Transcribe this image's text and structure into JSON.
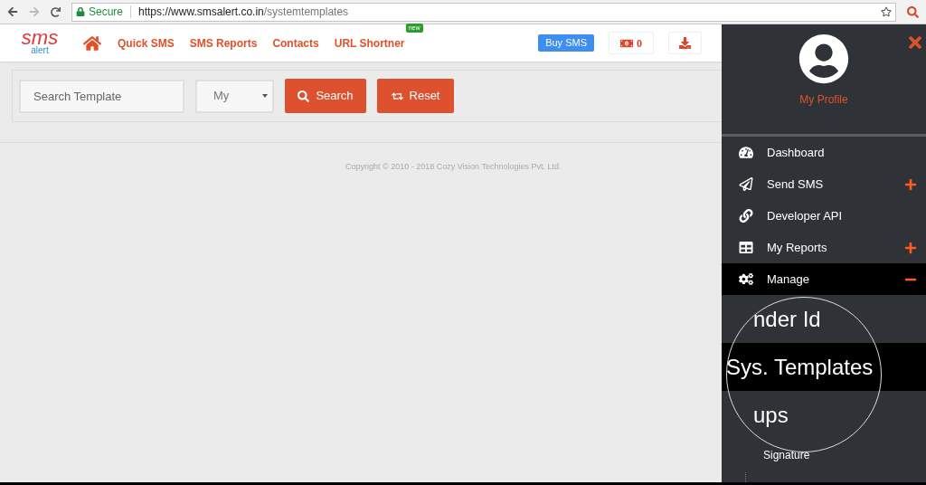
{
  "browser": {
    "secure_label": "Secure",
    "url_host": "https://www.smsalert.co.in",
    "url_path": "/systemtemplates"
  },
  "header": {
    "logo_main": "sms",
    "logo_sub": "alert",
    "nav": [
      {
        "label": "Quick SMS"
      },
      {
        "label": "SMS Reports"
      },
      {
        "label": "Contacts"
      },
      {
        "label": "URL Shortner",
        "badge": "new"
      }
    ],
    "buy_button": "Buy SMS",
    "credits": "0"
  },
  "filters": {
    "search_placeholder": "Search Template",
    "select_value": "My",
    "buttons": [
      {
        "label": "Search",
        "kind": "search"
      },
      {
        "label": "Reset",
        "kind": "reset"
      }
    ]
  },
  "footer": {
    "copyright": "Copyright © 2010 - 2018 Cozy Vision Technologies Pvt. Ltd."
  },
  "sidebar": {
    "profile_label": "My Profile",
    "menu": [
      {
        "label": "Dashboard",
        "kind": "dashboard",
        "selected": false
      },
      {
        "label": "Send SMS",
        "kind": "send",
        "selected": false,
        "expanded": false
      },
      {
        "label": "Developer API",
        "kind": "api",
        "selected": false
      },
      {
        "label": "My Reports",
        "kind": "reports",
        "selected": false,
        "expanded": false
      },
      {
        "label": "Manage",
        "kind": "manage",
        "selected": true,
        "expanded": true
      }
    ],
    "submenu": [
      {
        "label": "nder Id",
        "kind": "magnified",
        "selected": false
      },
      {
        "label": "Sys. Templates",
        "kind": "magnified",
        "selected": true
      },
      {
        "label": "ups",
        "kind": "magnified",
        "selected": false
      },
      {
        "label": "Signature",
        "kind": "normal",
        "selected": false
      }
    ]
  }
}
